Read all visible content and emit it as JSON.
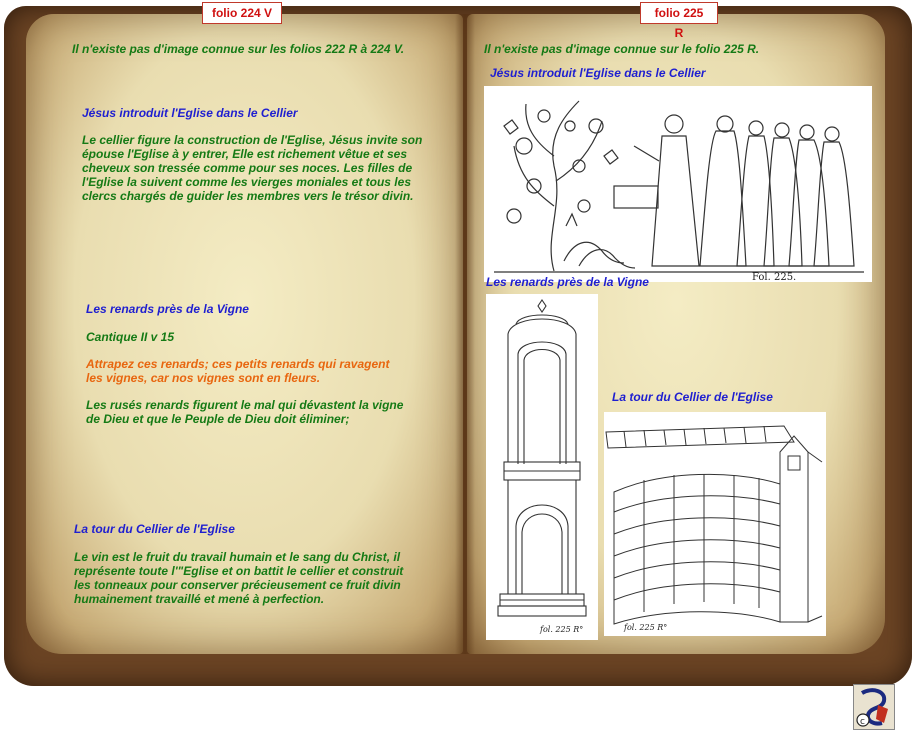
{
  "left_page": {
    "folio": "folio 224 V",
    "no_image": "Il n'existe pas d'image connue sur les folios 222 R à 224 V.",
    "section1": {
      "title": "Jésus introduit l'Eglise dans le Cellier",
      "body": "Le cellier figure la construction de l'Eglise, Jésus invite son épouse l'Eglise à y entrer, Elle est richement vêtue et ses cheveux son tressée comme pour ses noces. Les filles de l'Eglise la suivent comme les vierges moniales et tous les clercs chargés de guider les membres vers le trésor divin."
    },
    "section2": {
      "title": "Les renards près de la Vigne",
      "reference": "Cantique II v 15",
      "quote": "Attrapez ces renards; ces petits renards qui ravagent les vignes, car nos vignes sont en fleurs.",
      "body": "Les rusés renards figurent le mal qui dévastent la vigne de Dieu et que le Peuple de Dieu doit éliminer;"
    },
    "section3": {
      "title": "La tour du Cellier de l'Eglise",
      "body": "Le vin est le fruit du travail humain et le sang du Christ, il représente toute l'\"Eglise et on battit le cellier et construit les tonneaux pour conserver précieusement ce fruit divin humainement travaillé et mené à perfection."
    }
  },
  "right_page": {
    "folio": "folio 225 R",
    "no_image": "Il n'existe pas d'image connue sur le folio 225 R.",
    "caption_top": "Jésus introduit l'Eglise dans le Cellier",
    "caption_foxes": "Les renards près de la Vigne",
    "caption_tower": "La tour du Cellier de l'Eglise",
    "fol_label_1": "Fol. 225.",
    "fol_label_2": "fol. 225 R°",
    "fol_label_3": "fol. 225 R°"
  },
  "icons": {
    "copyright": "copyright-icon"
  }
}
